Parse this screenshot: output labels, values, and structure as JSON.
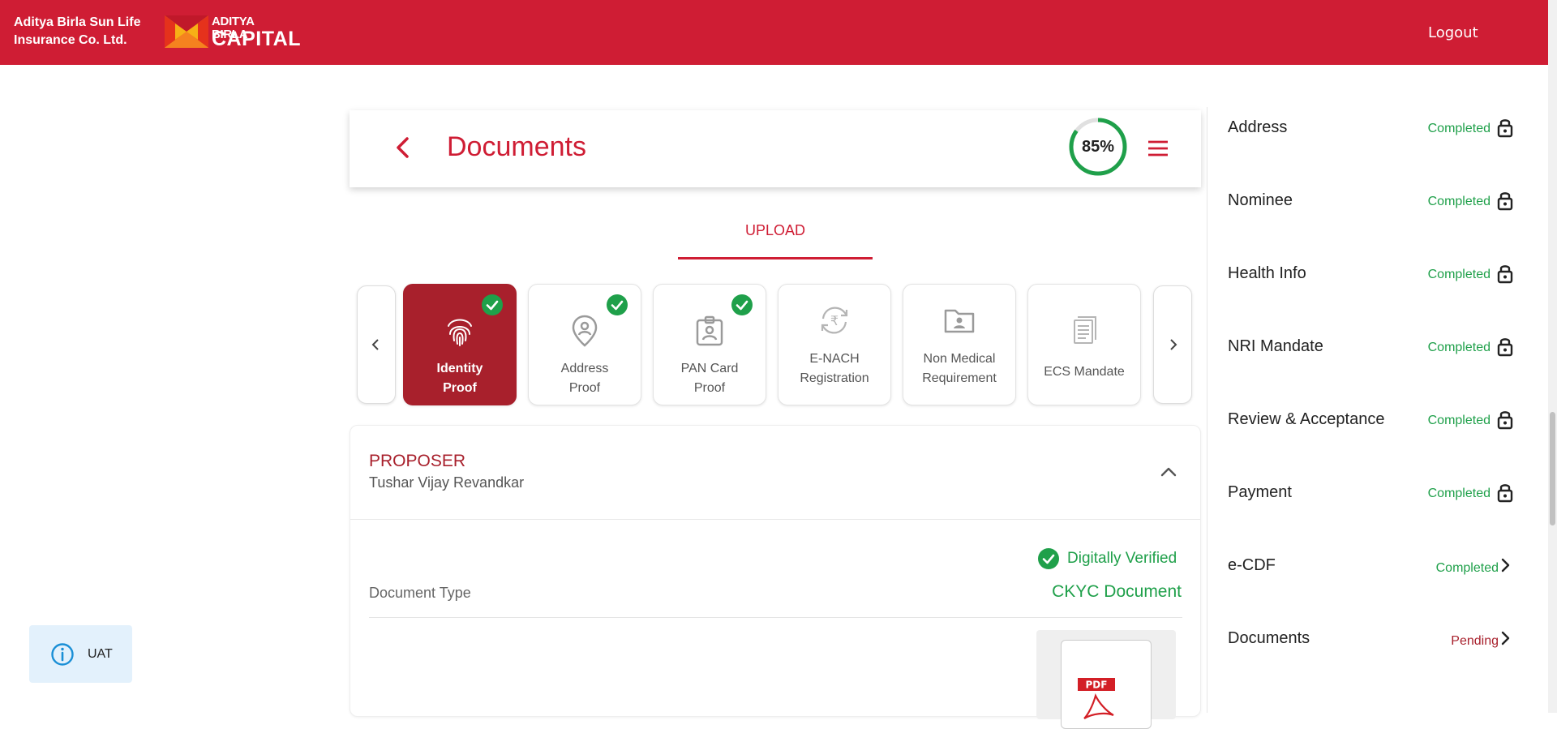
{
  "header": {
    "company_line1": "Aditya Birla Sun Life",
    "company_line2": "Insurance Co. Ltd.",
    "logo_top": "ADITYA BIRLA",
    "logo_bottom": "CAPITAL",
    "logout_label": "Logout"
  },
  "page": {
    "title": "Documents",
    "progress_percent": 85,
    "progress_label": "85%"
  },
  "tabs": {
    "upload_label": "UPLOAD"
  },
  "documents": [
    {
      "line1": "Identity",
      "line2": "Proof",
      "active": true,
      "checked": true,
      "icon": "fingerprint-icon"
    },
    {
      "line1": "Address",
      "line2": "Proof",
      "active": false,
      "checked": true,
      "icon": "location-pin-icon"
    },
    {
      "line1": "PAN Card",
      "line2": "Proof",
      "active": false,
      "checked": true,
      "icon": "id-badge-icon"
    },
    {
      "line1": "E-NACH",
      "line2": "Registration",
      "active": false,
      "checked": false,
      "icon": "rupee-refresh-icon"
    },
    {
      "line1": "Non Medical",
      "line2": "Requirement",
      "active": false,
      "checked": false,
      "icon": "folder-user-icon"
    },
    {
      "line1": "ECS Mandate",
      "line2": "",
      "active": false,
      "checked": false,
      "icon": "document-icon"
    }
  ],
  "proposer": {
    "title": "PROPOSER",
    "name": "Tushar Vijay Revandkar",
    "verified_label": "Digitally Verified",
    "doc_type_label": "Document Type",
    "doc_type_value": "CKYC Document",
    "pdf_label": "PDF"
  },
  "sidebar": {
    "items": [
      {
        "label": "Address",
        "status": "Completed",
        "icon": "lock-icon"
      },
      {
        "label": "Nominee",
        "status": "Completed",
        "icon": "lock-icon"
      },
      {
        "label": "Health Info",
        "status": "Completed",
        "icon": "lock-icon"
      },
      {
        "label": "NRI Mandate",
        "status": "Completed",
        "icon": "lock-icon"
      },
      {
        "label": "Review & Acceptance",
        "status": "Completed",
        "icon": "lock-icon"
      },
      {
        "label": "Payment",
        "status": "Completed",
        "icon": "lock-icon"
      },
      {
        "label": "e-CDF",
        "status": "Completed",
        "icon": "chevron-right-icon"
      },
      {
        "label": "Documents",
        "status": "Pending",
        "icon": "chevron-right-icon"
      }
    ]
  },
  "env_badge": {
    "label": "UAT"
  },
  "colors": {
    "brand_red": "#cf1d34",
    "active_card": "#a8202c",
    "success_green": "#1fa04a",
    "info_blue": "#1a8fd6"
  }
}
